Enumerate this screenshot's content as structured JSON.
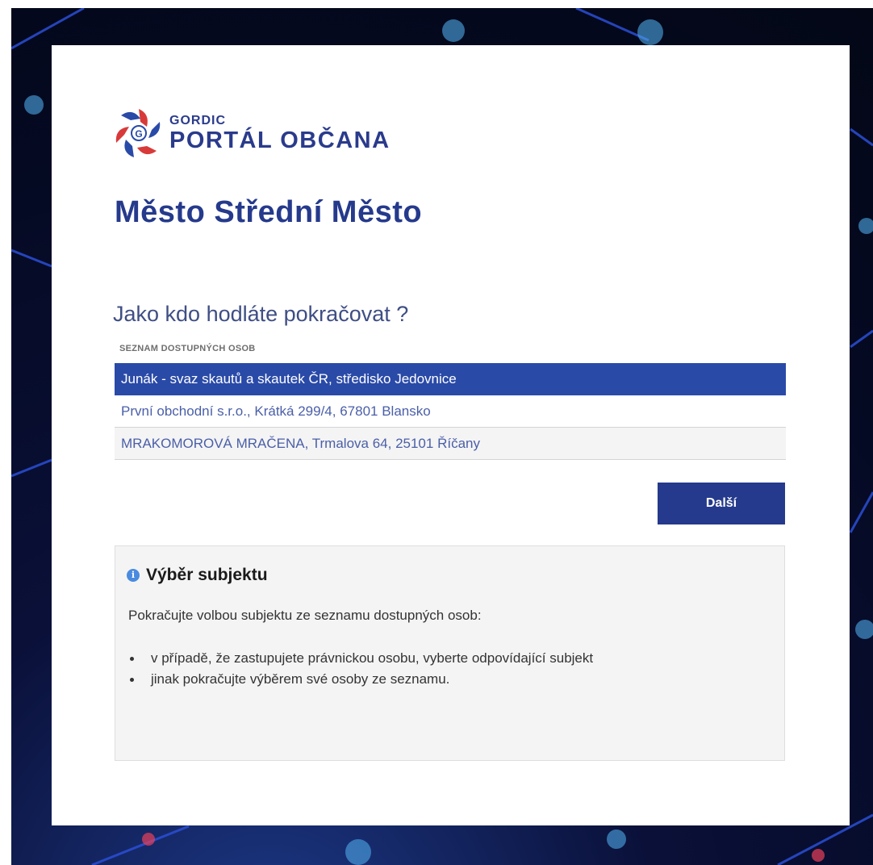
{
  "logo": {
    "small_text": "GORDIC",
    "big_text": "PORTÁL OBČANA"
  },
  "city_title": "Město Střední Město",
  "question": "Jako kdo hodláte pokračovat ?",
  "list_caption": "SEZNAM DOSTUPNÝCH OSOB",
  "persons": [
    {
      "label": "Junák - svaz skautů a skautek ČR, středisko Jedovnice",
      "selected": true
    },
    {
      "label": "První obchodní s.r.o., Krátká 299/4, 67801 Blansko",
      "selected": false
    },
    {
      "label": "MRAKOMOROVÁ MRAČENA, Trmalova 64, 25101 Říčany",
      "selected": false
    }
  ],
  "next_button_label": "Další",
  "info": {
    "icon": "info-icon",
    "title": "Výběr subjektu",
    "text": "Pokračujte volbou subjektu ze seznamu dostupných osob:",
    "items": [
      "v případě, že zastupujete právnickou osobu, vyberte odpovídající subjekt",
      "jinak pokračujte výběrem své osoby ze seznamu."
    ]
  },
  "colors": {
    "brand_blue": "#253a8c",
    "selected_row": "#2a4aa8",
    "info_icon": "#4a8be0"
  }
}
